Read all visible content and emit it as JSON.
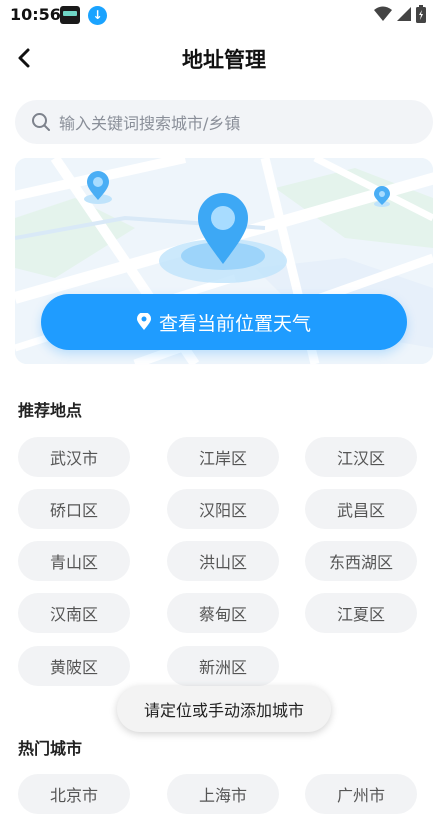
{
  "status": {
    "time": "10:56",
    "app_icon_1": "notification-app-icon",
    "app_icon_2": "download-icon"
  },
  "header": {
    "title": "地址管理",
    "back_icon": "chevron-left-icon"
  },
  "search": {
    "placeholder": "输入关键词搜索城市/乡镇",
    "icon": "search-icon"
  },
  "map": {
    "locate_button": "查看当前位置天气",
    "locate_icon": "location-pin-icon",
    "accent": "#1f9cff"
  },
  "recommended": {
    "title": "推荐地点",
    "items": [
      "武汉市",
      "江岸区",
      "江汉区",
      "硚口区",
      "汉阳区",
      "武昌区",
      "青山区",
      "洪山区",
      "东西湖区",
      "汉南区",
      "蔡甸区",
      "江夏区",
      "黄陂区",
      "新洲区"
    ]
  },
  "hot": {
    "title": "热门城市",
    "items": [
      "北京市",
      "上海市",
      "广州市"
    ]
  },
  "toast": {
    "text": "请定位或手动添加城市"
  }
}
